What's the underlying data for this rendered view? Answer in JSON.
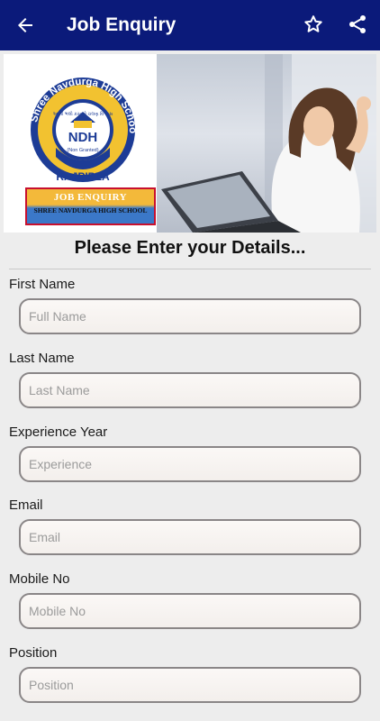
{
  "appbar": {
    "title": "Job Enquiry",
    "icons": [
      "arrow-back-icon",
      "star-outline-icon",
      "share-icon"
    ],
    "color": "#0b1a7a"
  },
  "banner": {
    "logo_arc_text": "Shree Navdurga High School",
    "logo_motto": "અ.નો ભલો કરતવો ચલણ વિશ્વાસ",
    "logo_initials": "NDH",
    "logo_note": "(Non Granted)",
    "logo_place": "RAJPIPLA",
    "enquiry_title": "JOB ENQUIRY",
    "enquiry_subtitle": "SHREE NAVDURGA HIGH SCHOOL"
  },
  "form": {
    "heading": "Please Enter your Details...",
    "fields": [
      {
        "label": "First Name",
        "placeholder": "Full Name",
        "value": ""
      },
      {
        "label": "Last Name",
        "placeholder": "Last Name",
        "value": ""
      },
      {
        "label": "Experience Year",
        "placeholder": "Experience",
        "value": ""
      },
      {
        "label": "Email",
        "placeholder": "Email",
        "value": ""
      },
      {
        "label": "Mobile No",
        "placeholder": "Mobile No",
        "value": ""
      },
      {
        "label": "Position",
        "placeholder": "Position",
        "value": ""
      }
    ]
  }
}
